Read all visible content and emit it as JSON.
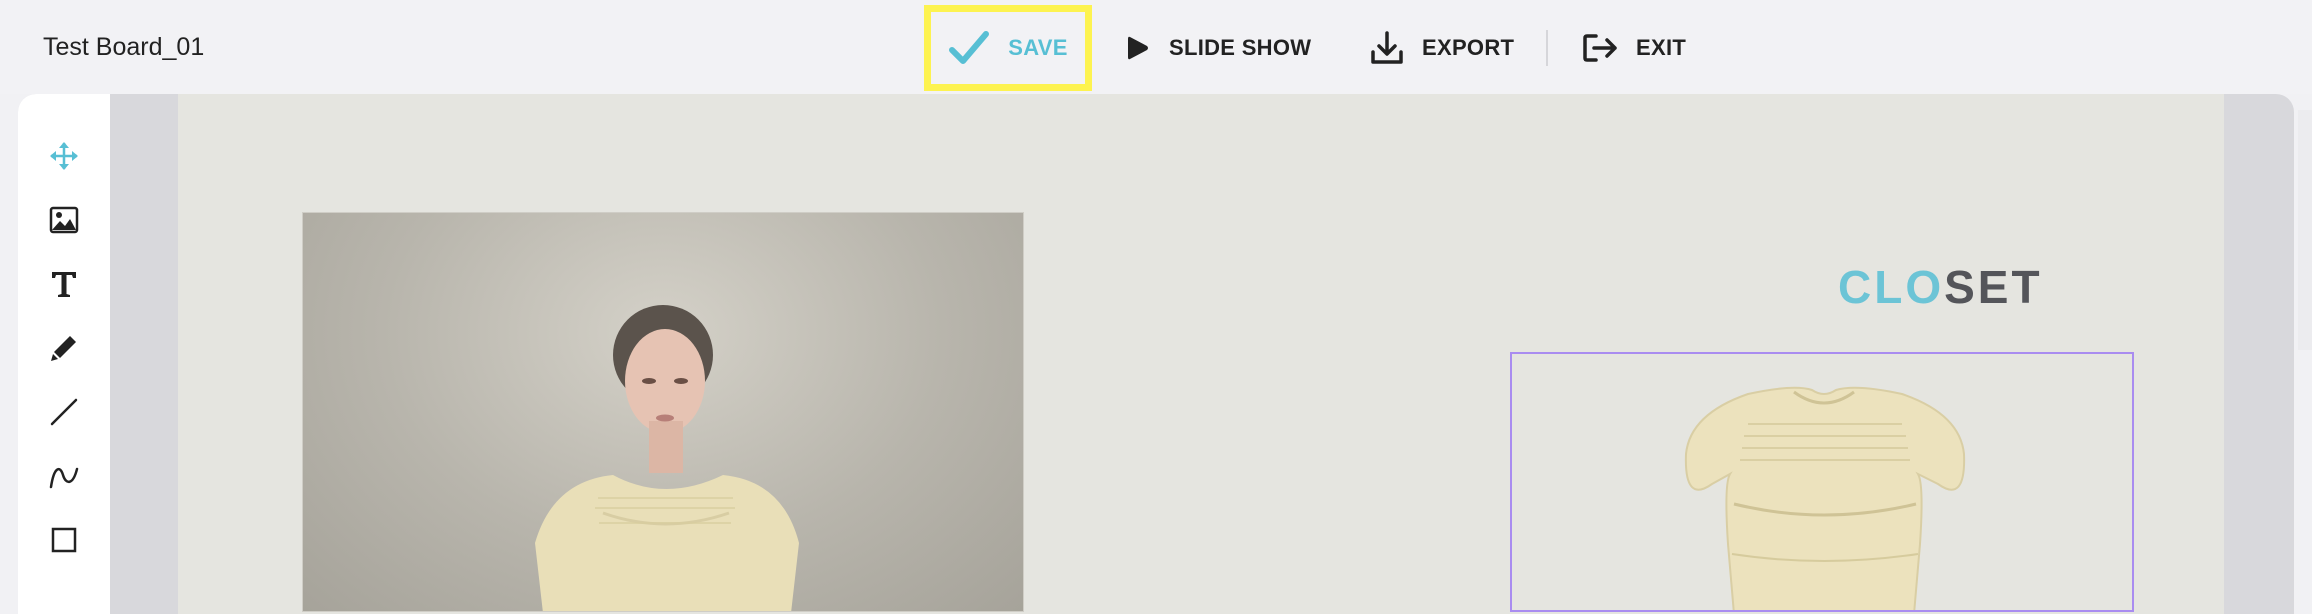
{
  "header": {
    "board_title": "Test Board_01",
    "save_label": "SAVE",
    "slideshow_label": "SLIDE SHOW",
    "export_label": "EXPORT",
    "exit_label": "EXIT"
  },
  "colors": {
    "accent": "#57bfd4",
    "highlight": "#fdf350",
    "selection": "#a98cf0"
  },
  "tools": [
    {
      "name": "move-tool",
      "icon": "move-arrows-icon",
      "active": true
    },
    {
      "name": "image-tool",
      "icon": "image-icon",
      "active": false
    },
    {
      "name": "text-tool",
      "icon": "text-icon",
      "active": false
    },
    {
      "name": "pen-tool",
      "icon": "pen-icon",
      "active": false
    },
    {
      "name": "line-tool",
      "icon": "line-icon",
      "active": false
    },
    {
      "name": "curve-tool",
      "icon": "curve-icon",
      "active": false
    },
    {
      "name": "rectangle-tool",
      "icon": "rectangle-icon",
      "active": false
    }
  ],
  "canvas": {
    "logo_part1": "CLO",
    "logo_part2": "SET"
  }
}
